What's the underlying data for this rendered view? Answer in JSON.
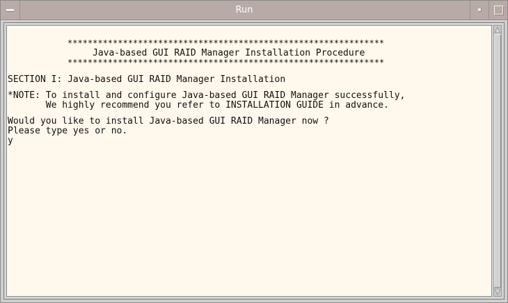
{
  "window": {
    "title": "Run"
  },
  "terminal": {
    "lines": [
      "***************************************************************",
      "Java-based GUI RAID Manager Installation Procedure",
      "***************************************************************",
      "SECTION I: Java-based GUI RAID Manager Installation",
      "*NOTE: To install and configure Java-based GUI RAID Manager successfully,",
      "       We highly recommend you refer to INSTALLATION GUIDE in advance.",
      "Would you like to install Java-based GUI RAID Manager now ?",
      "Please type yes or no.",
      "y"
    ]
  },
  "icons": {
    "window_menu": "window-menu-icon",
    "minimize": "minimize-icon",
    "maximize": "maximize-icon",
    "scroll_up": "scroll-up-arrow-icon",
    "scroll_down": "scroll-down-arrow-icon"
  },
  "colors": {
    "titlebar": "#b8aaa7",
    "terminal_bg": "#fff8ec",
    "text": "#111111"
  }
}
